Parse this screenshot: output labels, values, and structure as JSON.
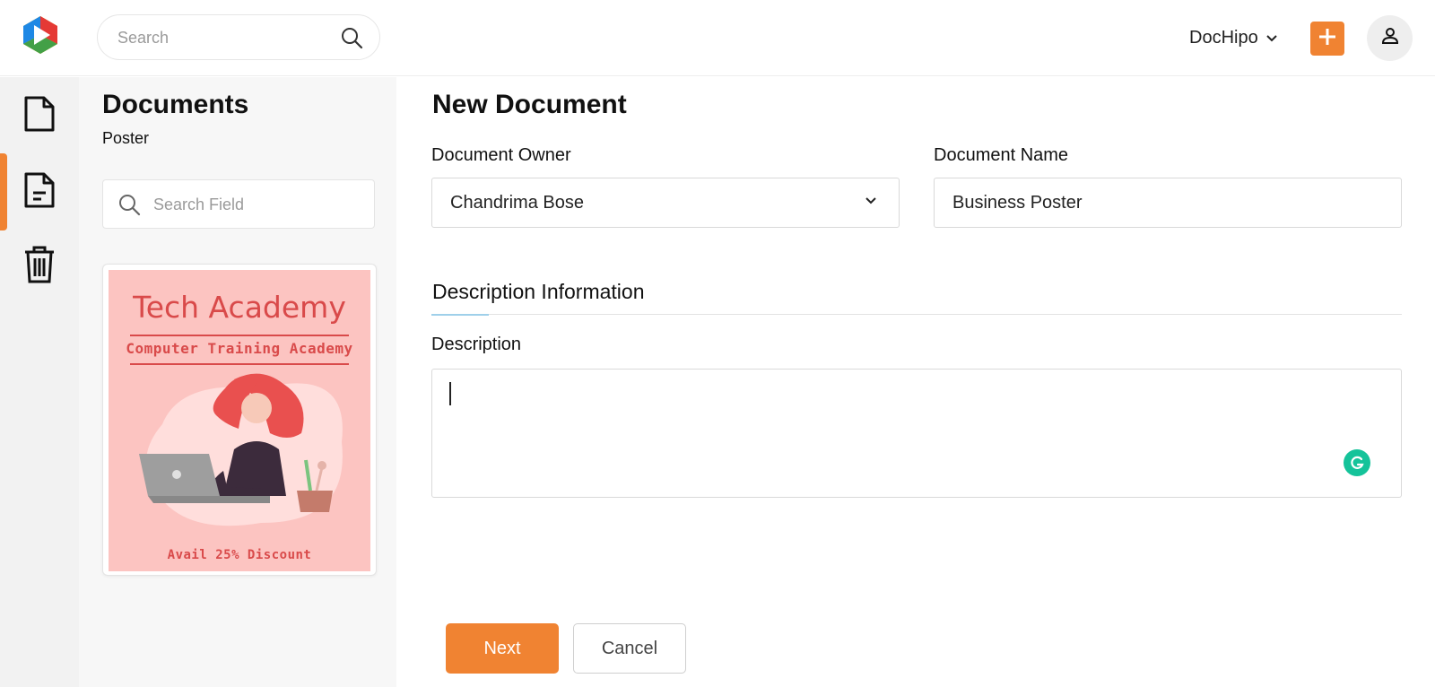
{
  "header": {
    "logo_icon": "dochipo-logo-icon",
    "search": {
      "placeholder": "Search",
      "icon": "search-icon"
    },
    "workspace_name": "DocHipo",
    "add_icon": "plus-icon",
    "profile_icon": "user-icon",
    "accent_color": "#f08332"
  },
  "rail": {
    "items": [
      {
        "icon": "document-icon",
        "active": false
      },
      {
        "icon": "document-lines-icon",
        "active": true
      },
      {
        "icon": "trash-icon",
        "active": false
      }
    ]
  },
  "documents_panel": {
    "title": "Documents",
    "subtitle": "Poster",
    "search": {
      "placeholder": "Search Field",
      "icon": "search-icon"
    },
    "template_card": {
      "title": "Tech Academy",
      "subtitle": "Computer Training Academy",
      "footer": "Avail 25% Discount",
      "background_color": "#fcc4c1",
      "text_color": "#d94a4a"
    }
  },
  "form": {
    "title": "New Document",
    "owner": {
      "label": "Document Owner",
      "value": "Chandrima Bose"
    },
    "name": {
      "label": "Document Name",
      "value": "Business Poster"
    },
    "section_title": "Description Information",
    "description": {
      "label": "Description",
      "value": ""
    },
    "next_label": "Next",
    "cancel_label": "Cancel"
  }
}
